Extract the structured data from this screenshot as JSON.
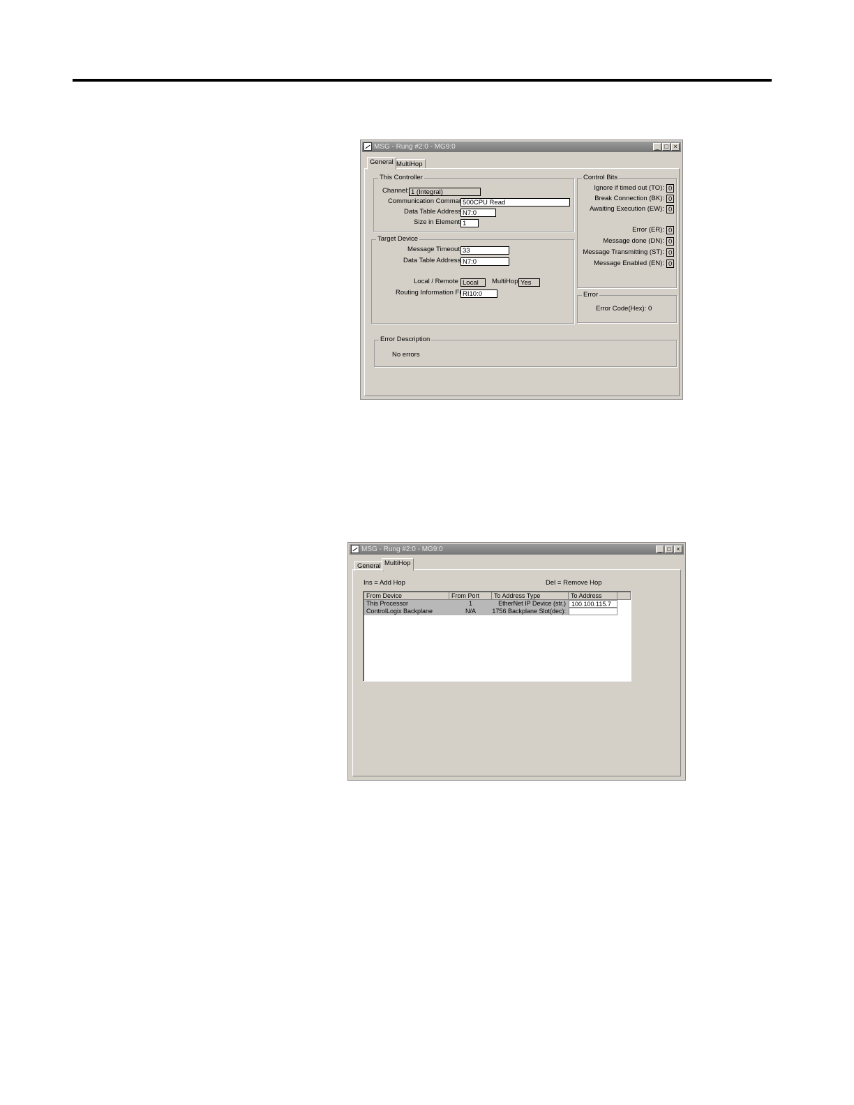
{
  "window1": {
    "title": "MSG - Rung #2:0 - MG9:0",
    "tabs": [
      "General",
      "MultiHop"
    ],
    "this_controller": {
      "legend": "This Controller",
      "channel_label": "Channel:",
      "channel_value": "1 (Integral)",
      "comm_command_label": "Communication Command:",
      "comm_command_value": "500CPU Read",
      "data_table_label": "Data Table Address:",
      "data_table_value": "N7:0",
      "size_label": "Size in Elements:",
      "size_value": "1"
    },
    "target_device": {
      "legend": "Target Device",
      "timeout_label": "Message Timeout :",
      "timeout_value": "33",
      "data_table_label": "Data Table Address:",
      "data_table_value": "N7:0",
      "local_remote_label": "Local / Remote :",
      "local_remote_value": "Local",
      "multihop_label": "MultiHop:",
      "multihop_value": "Yes",
      "routing_label": "Routing Information File:",
      "routing_value": "RI10:0"
    },
    "control_bits": {
      "legend": "Control Bits",
      "ignore_label": "Ignore if timed out (TO):",
      "ignore_value": "0",
      "break_label": "Break Connection (BK):",
      "break_value": "0",
      "awaiting_label": "Awaiting Execution (EW):",
      "awaiting_value": "0",
      "error_label": "Error (ER):",
      "error_value": "0",
      "done_label": "Message done (DN):",
      "done_value": "0",
      "transmitting_label": "Message Transmitting (ST):",
      "transmitting_value": "0",
      "enabled_label": "Message Enabled (EN):",
      "enabled_value": "0"
    },
    "error": {
      "legend": "Error",
      "code_text": "Error Code(Hex): 0"
    },
    "error_description": {
      "legend": "Error Description",
      "text": "No errors"
    }
  },
  "window2": {
    "title": "MSG - Rung #2:0 - MG9:0",
    "tabs": [
      "General",
      "MultiHop"
    ],
    "ins_hint": "Ins = Add Hop",
    "del_hint": "Del = Remove Hop",
    "columns": [
      "From Device",
      "From Port",
      "To Address Type",
      "To Address"
    ],
    "rows": [
      [
        "This Processor",
        "1",
        "EtherNet IP Device (str.)",
        "100.100.115.7"
      ],
      [
        "ControlLogix Backplane",
        "N/A",
        "1756 Backplane Slot(dec):",
        ""
      ]
    ]
  }
}
